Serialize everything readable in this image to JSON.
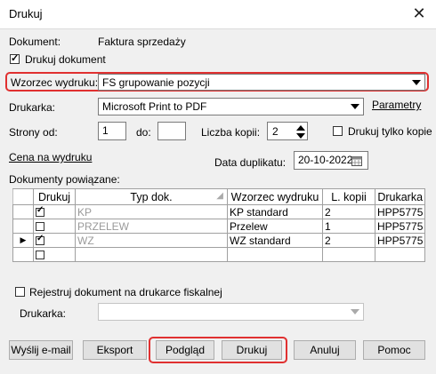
{
  "window": {
    "title": "Drukuj",
    "close_glyph": "✕"
  },
  "document": {
    "label": "Dokument:",
    "value": "Faktura sprzedaży"
  },
  "print_document": {
    "label": "Drukuj dokument",
    "checked": true
  },
  "template": {
    "label": "Wzorzec wydruku:",
    "value": "FS grupowanie pozycji"
  },
  "printer": {
    "label": "Drukarka:",
    "value": "Microsoft Print to PDF",
    "params_link": "Parametry"
  },
  "pages": {
    "from_label": "Strony od:",
    "from_value": "1",
    "to_label": "do:",
    "to_value": ""
  },
  "copies": {
    "label": "Liczba kopii:",
    "value": "2"
  },
  "copies_only": {
    "label": "Drukuj tylko kopie",
    "checked": false
  },
  "price_link": "Cena na wydruku",
  "duplicate_date": {
    "label": "Data duplikatu:",
    "value": "20-10-2022"
  },
  "related": {
    "label": "Dokumenty powiązane:",
    "columns": {
      "print": "Drukuj",
      "type": "Typ dok.",
      "template": "Wzorzec wydruku",
      "copies": "L. kopii",
      "printer": "Drukarka"
    },
    "rows": [
      {
        "checked": true,
        "type": "KP",
        "template": "KP standard",
        "copies": "2",
        "printer": "HPP5775"
      },
      {
        "checked": false,
        "type": "PRZELEW",
        "template": "Przelew",
        "copies": "1",
        "printer": "HPP5775"
      },
      {
        "checked": true,
        "type": "WZ",
        "template": "WZ standard",
        "copies": "2",
        "printer": "HPP5775"
      },
      {
        "checked": false,
        "type": "",
        "template": "",
        "copies": "",
        "printer": ""
      }
    ]
  },
  "fiscal": {
    "label": "Rejestruj dokument na drukarce fiskalnej",
    "checked": false,
    "printer_label": "Drukarka:",
    "printer_value": ""
  },
  "buttons": {
    "email": "Wyślij e-mail",
    "export": "Eksport",
    "preview": "Podgląd",
    "print": "Drukuj",
    "cancel": "Anuluj",
    "help": "Pomoc"
  },
  "colors": {
    "highlight": "#e03030",
    "background": "#f0f0f0"
  }
}
